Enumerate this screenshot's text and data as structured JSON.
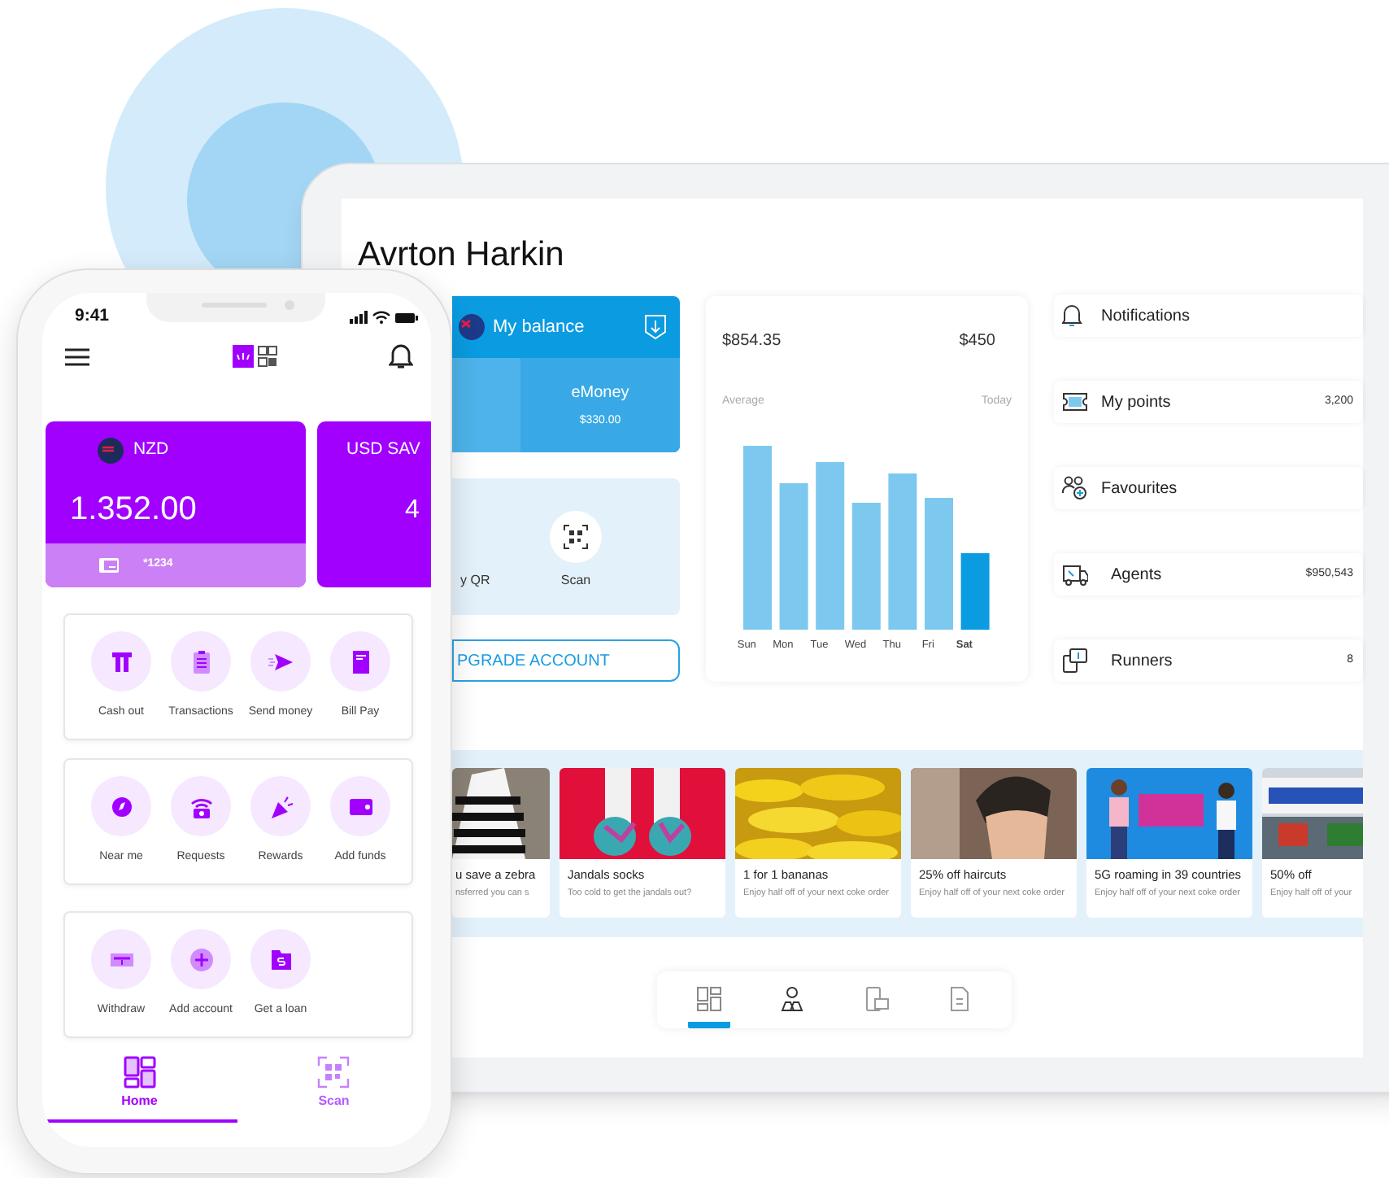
{
  "tablet": {
    "title": "Avrton Harkin",
    "balance_card": {
      "title": "My balance",
      "wallet_label": "eMoney",
      "wallet_amount": "$330.00"
    },
    "quick_actions": [
      {
        "label": "y QR"
      },
      {
        "label": "Scan"
      }
    ],
    "upgrade_button": "PGRADE ACCOUNT",
    "spending": {
      "average_amount": "$854.35",
      "today_amount": "$450",
      "average_label": "Average",
      "today_label": "Today",
      "days": [
        {
          "label": "Sun",
          "selected": false
        },
        {
          "label": "Mon",
          "selected": false
        },
        {
          "label": "Tue",
          "selected": false
        },
        {
          "label": "Wed",
          "selected": false
        },
        {
          "label": "Thu",
          "selected": false
        },
        {
          "label": "Fri",
          "selected": false
        },
        {
          "label": "Sat",
          "selected": true
        }
      ]
    },
    "menu": [
      {
        "label": "Notifications"
      },
      {
        "label": "My points",
        "value": "3,200"
      },
      {
        "label": "Favourites"
      },
      {
        "label": "Agents",
        "value": "$950,543"
      },
      {
        "label": "Runners",
        "value": "8"
      }
    ],
    "offers": [
      {
        "title": "u save a zebra",
        "subtitle": "nsferred you can s"
      },
      {
        "title": "Jandals socks",
        "subtitle": "Too cold to get the jandals out?"
      },
      {
        "title": "1 for 1 bananas",
        "subtitle": "Enjoy half off of your next coke order"
      },
      {
        "title": "25% off haircuts",
        "subtitle": "Enjoy half off of your next coke order"
      },
      {
        "title": "5G roaming in 39 countries",
        "subtitle": "Enjoy half off of your next coke order"
      },
      {
        "title": "50% off",
        "subtitle": "Enjoy half off of your"
      }
    ],
    "bottom_tabs": [
      {
        "selected": true
      },
      {
        "selected": false
      },
      {
        "selected": false
      },
      {
        "selected": false
      }
    ]
  },
  "phone": {
    "time": "9:41",
    "accounts": [
      {
        "currency": "NZD",
        "balance": "1.352.00",
        "card_number": "*1234"
      },
      {
        "currency": "USD SAV",
        "balance": "4"
      }
    ],
    "action_groups": [
      [
        {
          "label": "Cash out"
        },
        {
          "label": "Transactions"
        },
        {
          "label": "Send money"
        },
        {
          "label": "Bill Pay"
        }
      ],
      [
        {
          "label": "Near me"
        },
        {
          "label": "Requests"
        },
        {
          "label": "Rewards"
        },
        {
          "label": "Add funds"
        }
      ],
      [
        {
          "label": "Withdraw"
        },
        {
          "label": "Add account"
        },
        {
          "label": "Get a loan"
        }
      ]
    ],
    "nav": [
      {
        "label": "Home",
        "selected": true
      },
      {
        "label": "Scan",
        "selected": false
      }
    ]
  }
}
